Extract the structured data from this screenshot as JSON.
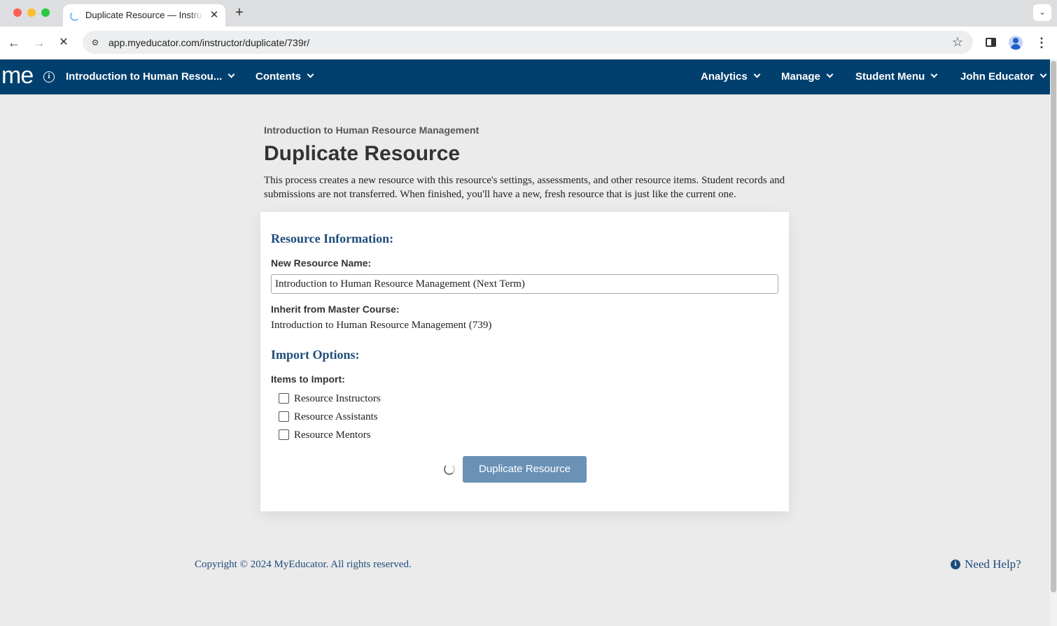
{
  "browser": {
    "tab_title": "Duplicate Resource — Instructor",
    "tab_close": "✕",
    "new_tab": "+",
    "tab_menu": "⌄",
    "url": "app.myeducator.com/instructor/duplicate/739r/",
    "icons": [
      "back-arrow-icon",
      "forward-arrow-icon",
      "stop-loading-icon",
      "site-settings-icon",
      "bookmark-star-icon",
      "side-panel-icon",
      "profile-icon",
      "kebab-menu-icon"
    ]
  },
  "nav": {
    "logo": "me",
    "course": "Introduction to Human Resou...",
    "contents": "Contents",
    "analytics": "Analytics",
    "manage": "Manage",
    "student_menu": "Student Menu",
    "user": "John Educator",
    "bar_color": "#003f6e"
  },
  "page": {
    "breadcrumb": "Introduction to Human Resource Management",
    "title": "Duplicate Resource",
    "description": "This process creates a new resource with this resource's settings, assessments, and other resource items. Student records and submissions are not transferred. When finished, you'll have a new, fresh resource that is just like the current one."
  },
  "form": {
    "resource_info_heading": "Resource Information:",
    "name_label": "New Resource Name:",
    "name_value": "Introduction to Human Resource Management (Next Term)",
    "inherit_label": "Inherit from Master Course:",
    "inherit_value": "Introduction to Human Resource Management (739)",
    "import_heading": "Import Options:",
    "items_label": "Items to Import:",
    "items": [
      {
        "label": "Resource Instructors",
        "checked": false
      },
      {
        "label": "Resource Assistants",
        "checked": false
      },
      {
        "label": "Resource Mentors",
        "checked": false
      }
    ],
    "submit_label": "Duplicate Resource",
    "submit_color": "#6a91b6"
  },
  "footer": {
    "copyright": "Copyright © 2024 MyEducator. All rights reserved.",
    "help": "Need Help?"
  }
}
